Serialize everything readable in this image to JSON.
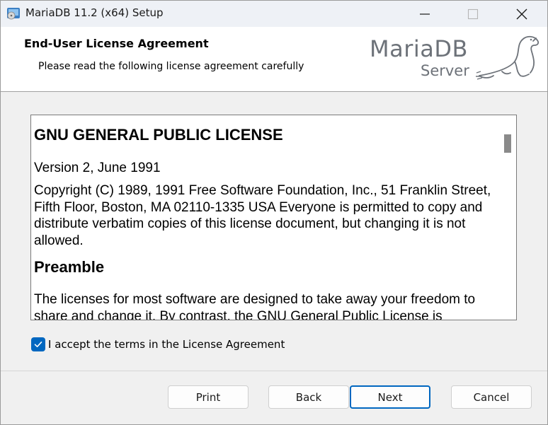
{
  "window": {
    "title": "MariaDB 11.2 (x64) Setup"
  },
  "banner": {
    "title": "End-User License Agreement",
    "subtitle": "Please read the following license agreement carefully",
    "logo_main": "MariaDB",
    "logo_sub": "Server"
  },
  "license": {
    "heading": "GNU GENERAL PUBLIC LICENSE",
    "version": "Version 2, June 1991",
    "copyright": "Copyright (C) 1989, 1991 Free Software Foundation, Inc., 51 Franklin Street, Fifth Floor, Boston, MA 02110-1335 USA Everyone is permitted to copy and distribute verbatim copies of this license document, but changing it is not allowed.",
    "preamble_heading": "Preamble",
    "preamble_text": "The licenses for most software are designed to take away your freedom to share and change it. By contrast, the GNU General Public License is"
  },
  "accept": {
    "label": "I accept the terms in the License Agreement",
    "checked": true
  },
  "buttons": {
    "print": "Print",
    "back": "Back",
    "next": "Next",
    "cancel": "Cancel"
  },
  "colors": {
    "accent": "#0067c0",
    "logo_gray": "#6d7279"
  }
}
